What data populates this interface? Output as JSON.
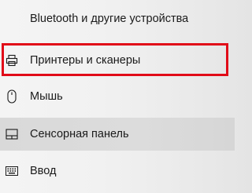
{
  "nav": {
    "items": [
      {
        "label": "Bluetooth и другие устройства",
        "icon": "bluetooth-devices-icon"
      },
      {
        "label": "Принтеры и сканеры",
        "icon": "printer-icon"
      },
      {
        "label": "Мышь",
        "icon": "mouse-icon"
      },
      {
        "label": "Сенсорная панель",
        "icon": "touchpad-icon"
      },
      {
        "label": "Ввод",
        "icon": "keyboard-icon"
      }
    ]
  },
  "highlight": {
    "color": "#e10b18"
  },
  "colors": {
    "selected_row_bg": "#d9d9d9",
    "text": "#1a1a1a"
  }
}
